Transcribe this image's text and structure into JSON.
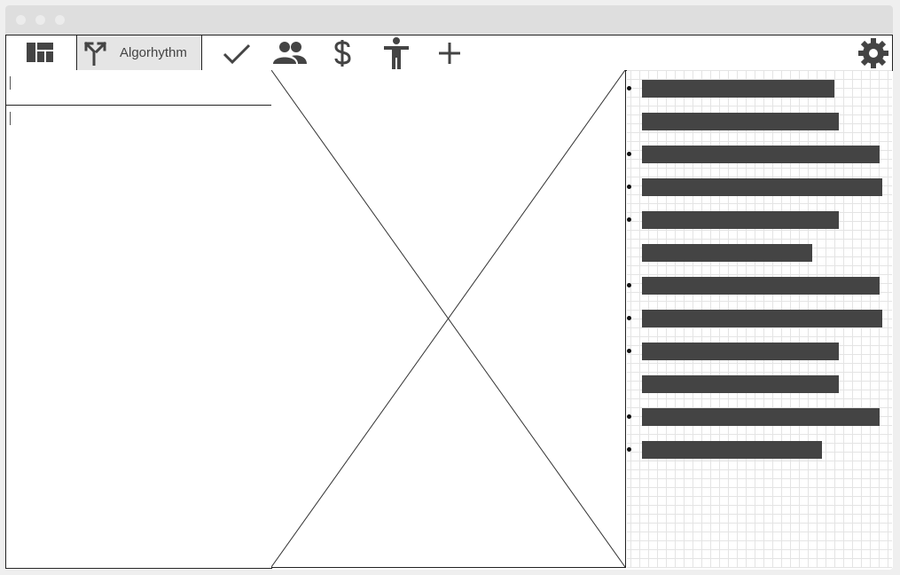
{
  "toolbar": {
    "active_tab_label": "Algorhythm",
    "buttons": [
      "dashboard-icon",
      "fork-icon",
      "check-icon",
      "people-icon",
      "dollar-icon",
      "accessibility-icon",
      "plus-icon",
      "gear-icon"
    ]
  },
  "left_panel": {
    "top_field": {
      "value": ""
    },
    "body_field": {
      "value": ""
    }
  },
  "list_items": [
    {
      "bullet": true,
      "fill": 0.8
    },
    {
      "bullet": false,
      "fill": 0.82
    },
    {
      "bullet": true,
      "fill": 0.99
    },
    {
      "bullet": true,
      "fill": 1.0
    },
    {
      "bullet": true,
      "fill": 0.82
    },
    {
      "bullet": false,
      "fill": 0.71
    },
    {
      "bullet": true,
      "fill": 0.99
    },
    {
      "bullet": true,
      "fill": 1.0
    },
    {
      "bullet": true,
      "fill": 0.82
    },
    {
      "bullet": false,
      "fill": 0.82
    },
    {
      "bullet": true,
      "fill": 0.99
    },
    {
      "bullet": true,
      "fill": 0.75
    }
  ],
  "colors": {
    "toolbar_icon": "#444444",
    "bar": "#444444",
    "active_tab_bg": "#e5e5e5",
    "grid_line": "#e4e4e4"
  }
}
